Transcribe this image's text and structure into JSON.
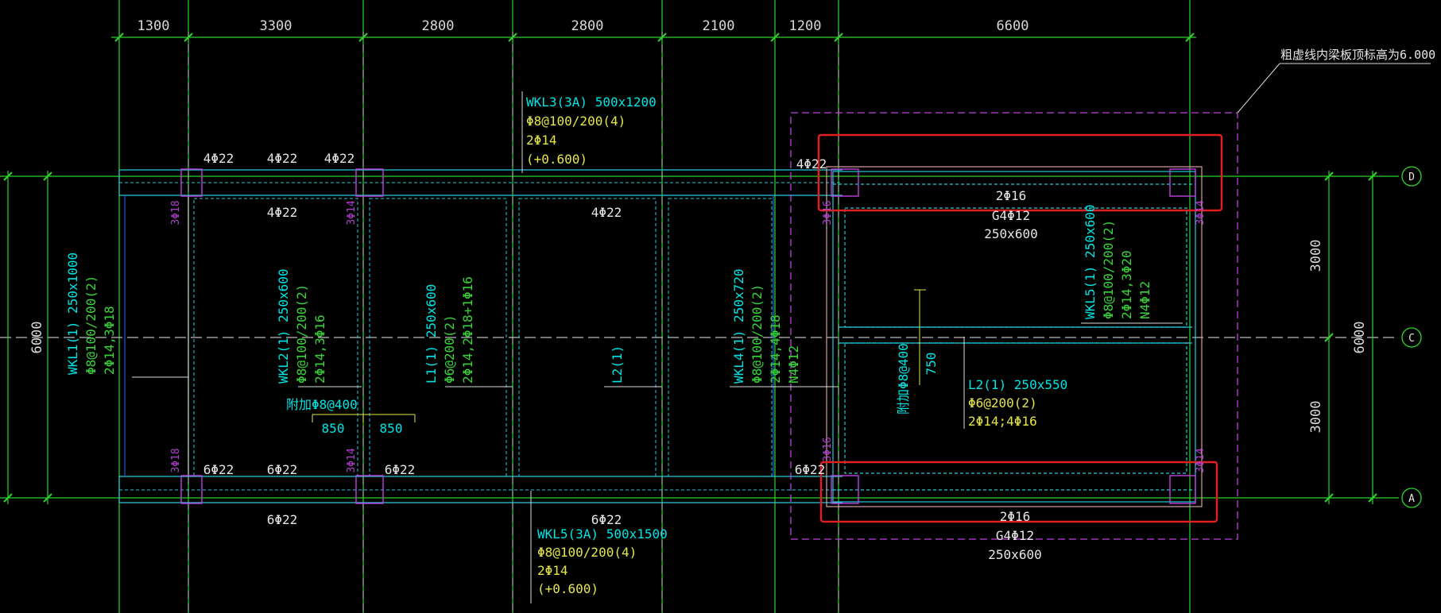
{
  "dimensions_top": [
    "1300",
    "3300",
    "2800",
    "2800",
    "2100",
    "1200",
    "6600"
  ],
  "dimensions_right": [
    "3000",
    "3000",
    "6000"
  ],
  "dimension_left": "6000",
  "axis_labels": [
    "D",
    "C",
    "A"
  ],
  "note": "粗虚线内梁板顶标高为6.000",
  "top_rebar": [
    "4Φ22",
    "4Φ22",
    "4Φ22",
    "4Φ22"
  ],
  "top_inner_rebar": [
    "4Φ22",
    "4Φ22"
  ],
  "bottom_rebar": [
    "6Φ22",
    "6Φ22",
    "6Φ22",
    "6Φ22"
  ],
  "bottom_outer_rebar": [
    "6Φ22",
    "6Φ22"
  ],
  "col_rebar": [
    "3Φ18",
    "3Φ14",
    "3Φ16",
    "3Φ14",
    "3Φ18",
    "3Φ14",
    "3Φ16",
    "3Φ14"
  ],
  "wkl3": [
    "WKL3(3A) 500x1200",
    "Φ8@100/200(4)",
    "2Φ14",
    "(+0.600)"
  ],
  "wkl5_3a": [
    "WKL5(3A) 500x1500",
    "Φ8@100/200(4)",
    "2Φ14",
    "(+0.600)"
  ],
  "wkl1": [
    "WKL1(1) 250x1000",
    "Φ8@100/200(2)",
    "2Φ14,3Φ18"
  ],
  "wkl2": [
    "WKL2(1) 250x600",
    "Φ8@100/200(2)",
    "2Φ14,3Φ16"
  ],
  "l1": [
    "L1(1) 250x600",
    "Φ6@200(2)",
    "2Φ14,2Φ18+1Φ16"
  ],
  "l2_short": "L2(1)",
  "wkl4": [
    "WKL4(1) 250x720",
    "Φ8@100/200(2)",
    "2Φ14,4Φ18",
    "N4Φ12"
  ],
  "wkl5_1": [
    "WKL5(1) 250x600",
    "Φ8@100/200(2)",
    "2Φ14,3Φ20",
    "N4Φ12"
  ],
  "l2_full": [
    "L2(1) 250x550",
    "Φ6@200(2)",
    "2Φ14;4Φ16"
  ],
  "add_hoop_1": "附加Φ8@400",
  "add_hoop_2": "附加Φ8@400",
  "spacing_850": [
    "850",
    "850"
  ],
  "spacing_750": "750",
  "top_beam_right": [
    "2Φ16",
    "G4Φ12",
    "250x600"
  ],
  "bottom_beam_right": [
    "2Φ16",
    "G4Φ12",
    "250x600"
  ]
}
